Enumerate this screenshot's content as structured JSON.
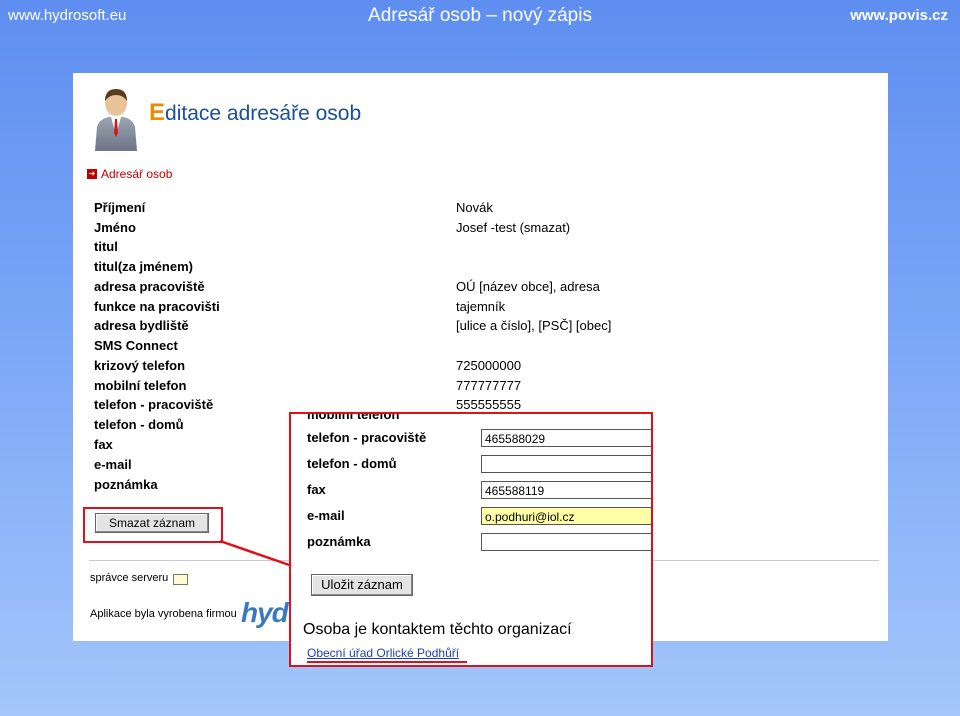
{
  "slide": {
    "site_left": "www.hydrosoft.eu",
    "title": "Adresář osob – nový zápis",
    "site_right": "www.povis.cz"
  },
  "page": {
    "heading_first": "E",
    "heading_rest": "ditace adresáře osob",
    "breadcrumb": "Adresář osob",
    "fields": [
      {
        "label": "Příjmení",
        "value": "Novák"
      },
      {
        "label": "Jméno",
        "value": "Josef -test (smazat)"
      },
      {
        "label": "titul",
        "value": ""
      },
      {
        "label": "titul(za jménem)",
        "value": ""
      },
      {
        "label": "adresa pracoviště",
        "value": "OÚ [název obce], adresa"
      },
      {
        "label": "funkce na pracovišti",
        "value": "tajemník"
      },
      {
        "label": "adresa bydliště",
        "value": "[ulice a číslo], [PSČ] [obec]"
      },
      {
        "label": "SMS Connect",
        "value": ""
      },
      {
        "label": "krizový telefon",
        "value": "725000000"
      },
      {
        "label": "mobilní telefon",
        "value": "777777777"
      },
      {
        "label": "telefon - pracoviště",
        "value": "555555555"
      },
      {
        "label": "telefon - domů",
        "value": ""
      },
      {
        "label": "fax",
        "value": ""
      },
      {
        "label": "e-mail",
        "value": ""
      },
      {
        "label": "poznámka",
        "value": ""
      }
    ],
    "delete_button": "Smazat záznam",
    "admin_label": "správce serveru",
    "made_by_label": "Aplikace byla vyrobena firmou",
    "logo_fragment": "hyd"
  },
  "zoom": {
    "fields": [
      {
        "label": "telefon - pracoviště",
        "value": "465588029",
        "highlight": false
      },
      {
        "label": "telefon - domů",
        "value": "",
        "highlight": false
      },
      {
        "label": "fax",
        "value": "465588119",
        "highlight": false
      },
      {
        "label": "e-mail",
        "value": "o.podhuri@iol.cz",
        "highlight": true
      },
      {
        "label": "poznámka",
        "value": "",
        "highlight": false
      }
    ],
    "save_button": "Uložit záznam",
    "contact_heading": "Osoba je kontaktem těchto organizací",
    "contact_link": "Obecní úřad Orlické Podhůří"
  },
  "colors": {
    "accent_red": "#e0101a",
    "heading_blue": "#1c4f96",
    "heading_orange": "#f08a00",
    "link_blue": "#1d3fb3",
    "input_highlight": "#ffffa8"
  }
}
